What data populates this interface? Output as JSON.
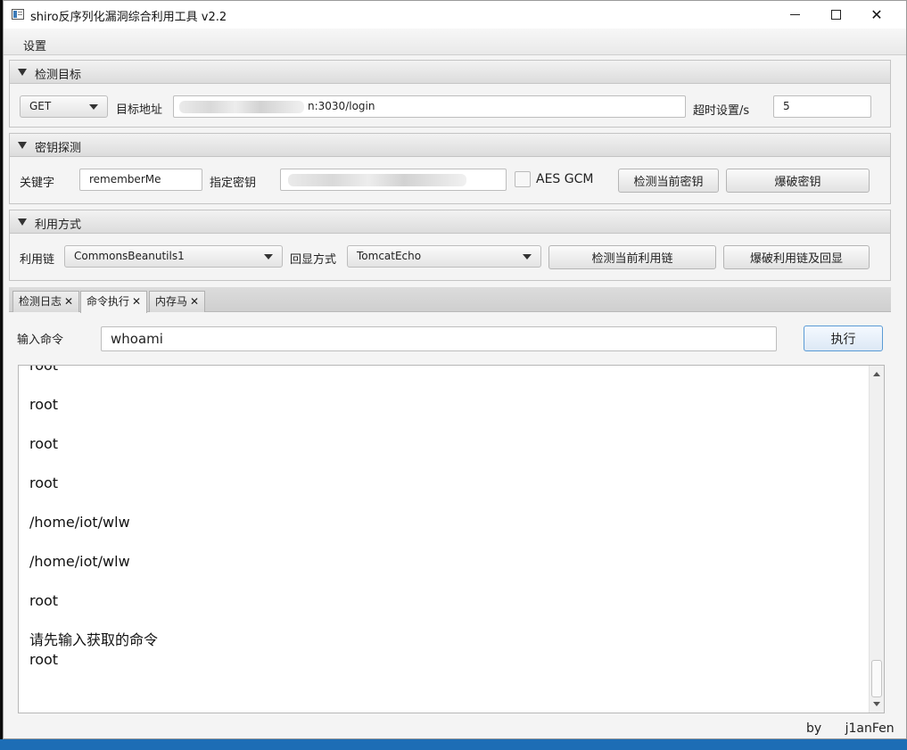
{
  "window": {
    "title": "shiro反序列化漏洞综合利用工具 v2.2",
    "close_glyph": "✕"
  },
  "menu": {
    "settings": "设置"
  },
  "target_panel": {
    "title": "检测目标",
    "method": "GET",
    "address_label": "目标地址",
    "address_value": "n:3030/login",
    "timeout_label": "超时设置/s",
    "timeout_value": "5"
  },
  "key_panel": {
    "title": "密钥探测",
    "keyword_label": "关键字",
    "keyword_value": "rememberMe",
    "key_label": "指定密钥",
    "aes_gcm_label": "AES GCM",
    "check_key_button": "检测当前密钥",
    "brute_key_button": "爆破密钥"
  },
  "exploit_panel": {
    "title": "利用方式",
    "chain_label": "利用链",
    "chain_value": "CommonsBeanutils1",
    "echo_label": "回显方式",
    "echo_value": "TomcatEcho",
    "check_chain_button": "检测当前利用链",
    "brute_chain_button": "爆破利用链及回显"
  },
  "tabs": [
    {
      "label": "检测日志",
      "close": "✕"
    },
    {
      "label": "命令执行",
      "close": "✕"
    },
    {
      "label": "内存马",
      "close": "✕"
    }
  ],
  "command": {
    "input_label": "输入命令",
    "input_value": "whoami",
    "execute_button": "执行"
  },
  "output": {
    "text": "root\n\nroot\n\nroot\n\nroot\n\n/home/iot/wlw\n\n/home/iot/wlw\n\nroot\n\n请先输入获取的命令\nroot"
  },
  "footer": {
    "by": "by",
    "author": "j1anFen"
  }
}
